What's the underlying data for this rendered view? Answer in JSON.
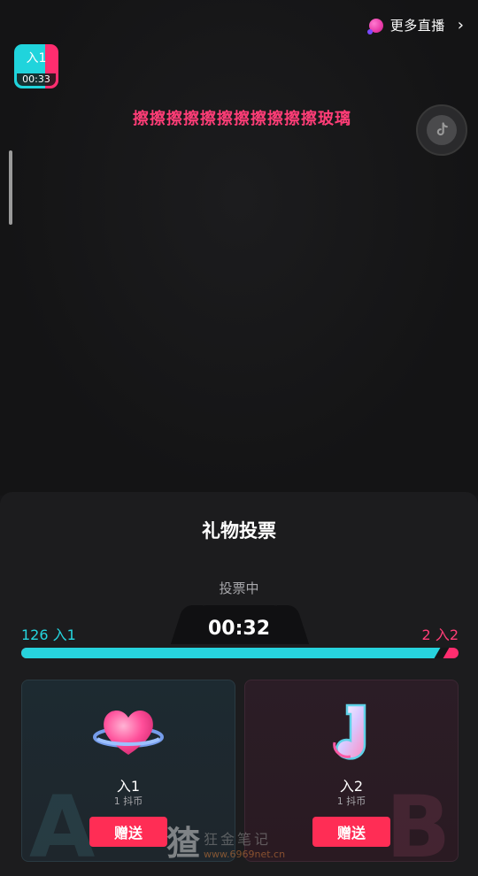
{
  "top": {
    "more_live_label": "更多直播",
    "badge": {
      "name": "入1",
      "time": "00:33"
    },
    "banner_text": "擦擦擦擦擦擦擦擦擦擦擦玻璃"
  },
  "vote": {
    "title": "礼物投票",
    "status": "投票中",
    "timer": "00:32",
    "left": {
      "score_label": "126 入1",
      "votes": 126
    },
    "right": {
      "score_label": "2 入2",
      "votes": 2
    },
    "progress_left_fraction": 0.96,
    "options": [
      {
        "name": "入1",
        "price": "1 抖币",
        "button": "赠送",
        "watermark": "A",
        "icon": "heart-planet-icon"
      },
      {
        "name": "入2",
        "price": "1 抖币",
        "button": "赠送",
        "watermark": "B",
        "icon": "music-note-icon"
      }
    ]
  },
  "watermark": {
    "glyph": "猹",
    "brand": "狂金笔记",
    "url": "www.6969net.cn"
  },
  "colors": {
    "cyan": "#27d3dd",
    "pink": "#ff2d6f",
    "send": "#ff2d55",
    "banner": "#ff3d77"
  }
}
